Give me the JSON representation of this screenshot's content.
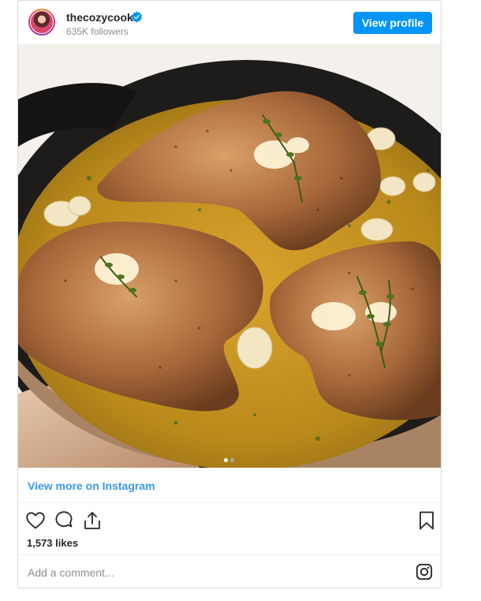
{
  "post": {
    "username": "thecozycook",
    "verified": true,
    "followers": "635K followers",
    "view_profile_label": "View profile",
    "carousel": {
      "count": 2,
      "active": 1
    },
    "view_more_label": "View more on Instagram",
    "likes": "1,573 likes",
    "comment_placeholder": "Add a comment..."
  },
  "icons": {
    "verified": "verified-badge-icon",
    "like": "heart-icon",
    "comment": "comment-bubble-icon",
    "share": "share-icon",
    "save": "bookmark-icon",
    "instagram": "instagram-logo-icon"
  },
  "colors": {
    "accent": "#0095f6",
    "link": "#3897f0",
    "muted": "#8e8e8e",
    "text": "#262626",
    "border": "#dbdbdb"
  }
}
